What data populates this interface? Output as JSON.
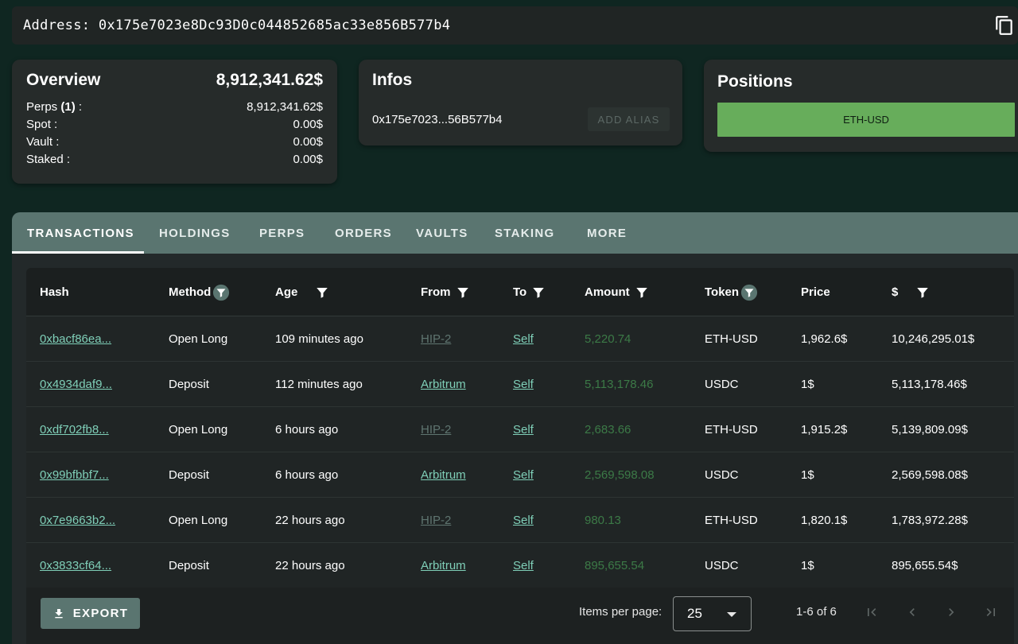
{
  "address_bar": {
    "text": "Address: 0x175e7023e8Dc93D0c044852685ac33e856B577b4",
    "copy_icon": "copy-icon"
  },
  "overview": {
    "title": "Overview",
    "total": "8,912,341.62$",
    "rows": [
      {
        "label_prefix": "Perps ",
        "label_bold": "(1)",
        "label_suffix": " :",
        "value": "8,912,341.62$"
      },
      {
        "label_prefix": "Spot :",
        "label_bold": "",
        "label_suffix": "",
        "value": "0.00$"
      },
      {
        "label_prefix": "Vault :",
        "label_bold": "",
        "label_suffix": "",
        "value": "0.00$"
      },
      {
        "label_prefix": "Staked :",
        "label_bold": "",
        "label_suffix": "",
        "value": "0.00$"
      }
    ]
  },
  "infos": {
    "title": "Infos",
    "short_address": "0x175e7023...56B577b4",
    "alias_button": "ADD ALIAS"
  },
  "positions": {
    "title": "Positions",
    "items": [
      "ETH-USD"
    ],
    "accent": "#67ad5b"
  },
  "tabs": [
    {
      "label": "TRANSACTIONS",
      "active": true
    },
    {
      "label": "HOLDINGS",
      "active": false
    },
    {
      "label": "PERPS",
      "active": false
    },
    {
      "label": "ORDERS",
      "active": false
    },
    {
      "label": "VAULTS",
      "active": false
    },
    {
      "label": "STAKING",
      "active": false
    },
    {
      "label": "MORE",
      "active": false
    }
  ],
  "table": {
    "columns": [
      {
        "label": "Hash",
        "filter": "none"
      },
      {
        "label": "Method",
        "filter": "circled"
      },
      {
        "label": "Age",
        "filter": "plain"
      },
      {
        "label": "From",
        "filter": "plain"
      },
      {
        "label": "To",
        "filter": "plain"
      },
      {
        "label": "Amount",
        "filter": "plain"
      },
      {
        "label": "Token",
        "filter": "circled"
      },
      {
        "label": "Price",
        "filter": "none"
      },
      {
        "label": "$",
        "filter": "plain"
      }
    ],
    "rows": [
      {
        "hash": "0xbacf86ea...",
        "method": "Open Long",
        "age": "109 minutes ago",
        "from": "HIP-2",
        "to": "Self",
        "amount": "5,220.74",
        "token": "ETH-USD",
        "price": "1,962.6$",
        "usd": "10,246,295.01$"
      },
      {
        "hash": "0x4934daf9...",
        "method": "Deposit",
        "age": "112 minutes ago",
        "from": "Arbitrum",
        "to": "Self",
        "amount": "5,113,178.46",
        "token": "USDC",
        "price": "1$",
        "usd": "5,113,178.46$"
      },
      {
        "hash": "0xdf702fb8...",
        "method": "Open Long",
        "age": "6 hours ago",
        "from": "HIP-2",
        "to": "Self",
        "amount": "2,683.66",
        "token": "ETH-USD",
        "price": "1,915.2$",
        "usd": "5,139,809.09$"
      },
      {
        "hash": "0x99bfbbf7...",
        "method": "Deposit",
        "age": "6 hours ago",
        "from": "Arbitrum",
        "to": "Self",
        "amount": "2,569,598.08",
        "token": "USDC",
        "price": "1$",
        "usd": "2,569,598.08$"
      },
      {
        "hash": "0x7e9663b2...",
        "method": "Open Long",
        "age": "22 hours ago",
        "from": "HIP-2",
        "to": "Self",
        "amount": "980.13",
        "token": "ETH-USD",
        "price": "1,820.1$",
        "usd": "1,783,972.28$"
      },
      {
        "hash": "0x3833cf64...",
        "method": "Deposit",
        "age": "22 hours ago",
        "from": "Arbitrum",
        "to": "Self",
        "amount": "895,655.54",
        "token": "USDC",
        "price": "1$",
        "usd": "895,655.54$"
      }
    ]
  },
  "footer": {
    "export_label": "EXPORT",
    "items_per_page_label": "Items per page:",
    "items_per_page_value": "25",
    "range_label": "1-6 of 6",
    "pager_icons": [
      "first-page-icon",
      "prev-page-icon",
      "next-page-icon",
      "last-page-icon"
    ]
  }
}
